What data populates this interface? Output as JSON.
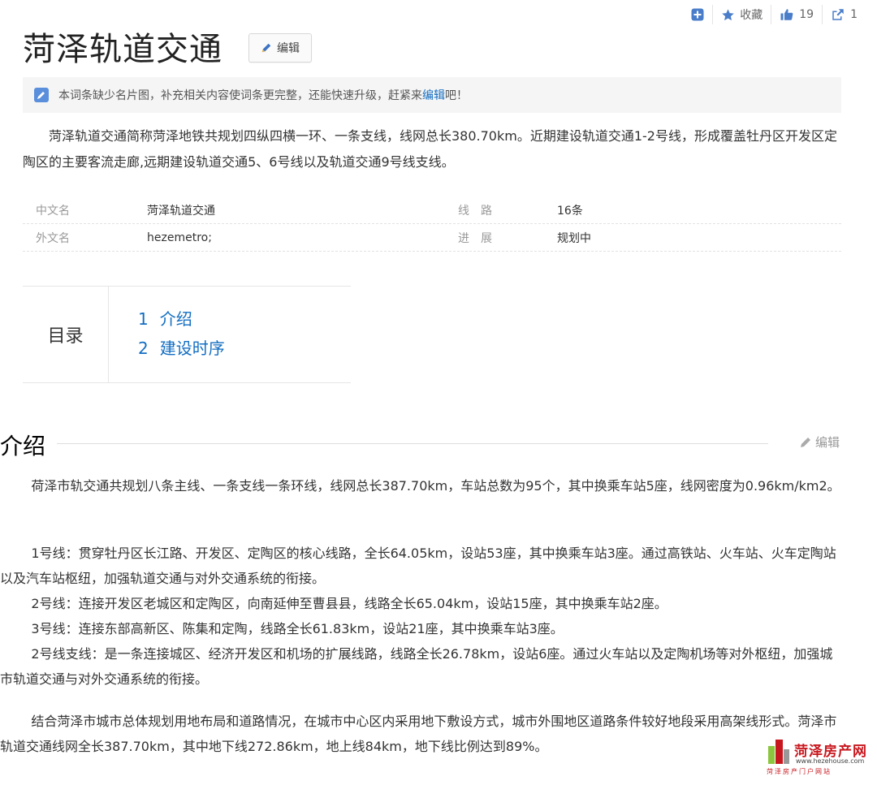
{
  "toolbar": {
    "collect_label": "收藏",
    "like_count": "19",
    "share_count": "1"
  },
  "header": {
    "title": "菏泽轨道交通",
    "edit_label": "编辑"
  },
  "notice": {
    "text": "本词条缺少名片图，补充相关内容使词条更完整，还能快速升级，赶紧来",
    "link": "编辑",
    "suffix": "吧！"
  },
  "summary": "菏泽轨道交通简称菏泽地铁共规划四纵四横一环、一条支线，线网总长380.70km。近期建设轨道交通1-2号线，形成覆盖牡丹区开发区定陶区的主要客流走廊,远期建设轨道交通5、6号线以及轨道交通9号线支线。",
  "basic_info": {
    "rows": [
      {
        "k1": "中文名",
        "v1": "菏泽轨道交通",
        "k2": "线　路",
        "v2": "16条"
      },
      {
        "k1": "外文名",
        "v1": "hezemetro;",
        "k2": "进　展",
        "v2": "规划中"
      }
    ]
  },
  "toc": {
    "label": "目录",
    "items": [
      {
        "num": "1",
        "label": "介绍"
      },
      {
        "num": "2",
        "label": "建设时序"
      }
    ]
  },
  "section": {
    "title": "介绍",
    "edit_label": "编辑"
  },
  "paragraphs": [
    "荷泽市轨交通共规划八条主线、一条支线一条环线，线网总长387.70km，车站总数为95个，其中换乘车站5座，线网密度为0.96km/km2。",
    "1号线：贯穿牡丹区长江路、开发区、定陶区的核心线路，全长64.05km，设站53座，其中换乘车站3座。通过高铁站、火车站、火车定陶站以及汽车站枢纽，加强轨道交通与对外交通系统的衔接。",
    "2号线：连接开发区老城区和定陶区，向南延伸至曹县县，线路全长65.04km，设站15座，其中换乘车站2座。",
    "3号线：连接东部高新区、陈集和定陶，线路全长61.83km，设站21座，其中换乘车站3座。",
    "2号线支线：是一条连接城区、经济开发区和机场的扩展线路，线路全长26.78km，设站6座。通过火车站以及定陶机场等对外枢纽，加强城市轨道交通与对外交通系统的衔接。",
    "结合菏泽市城市总体规划用地布局和道路情况，在城市中心区内采用地下敷设方式，城市外围地区道路条件较好地段采用高架线形式。菏泽市轨道交通线网全长387.70km，其中地下线272.86km，地上线84km，地下线比例达到89%。"
  ],
  "watermark": {
    "name": "菏泽房产网",
    "url": "www.hezehouse.com",
    "sub": "菏泽房产门户网站"
  },
  "colors": {
    "link": "#136ec2",
    "icon": "#4a7dc9",
    "watermark": "#c8181f"
  }
}
